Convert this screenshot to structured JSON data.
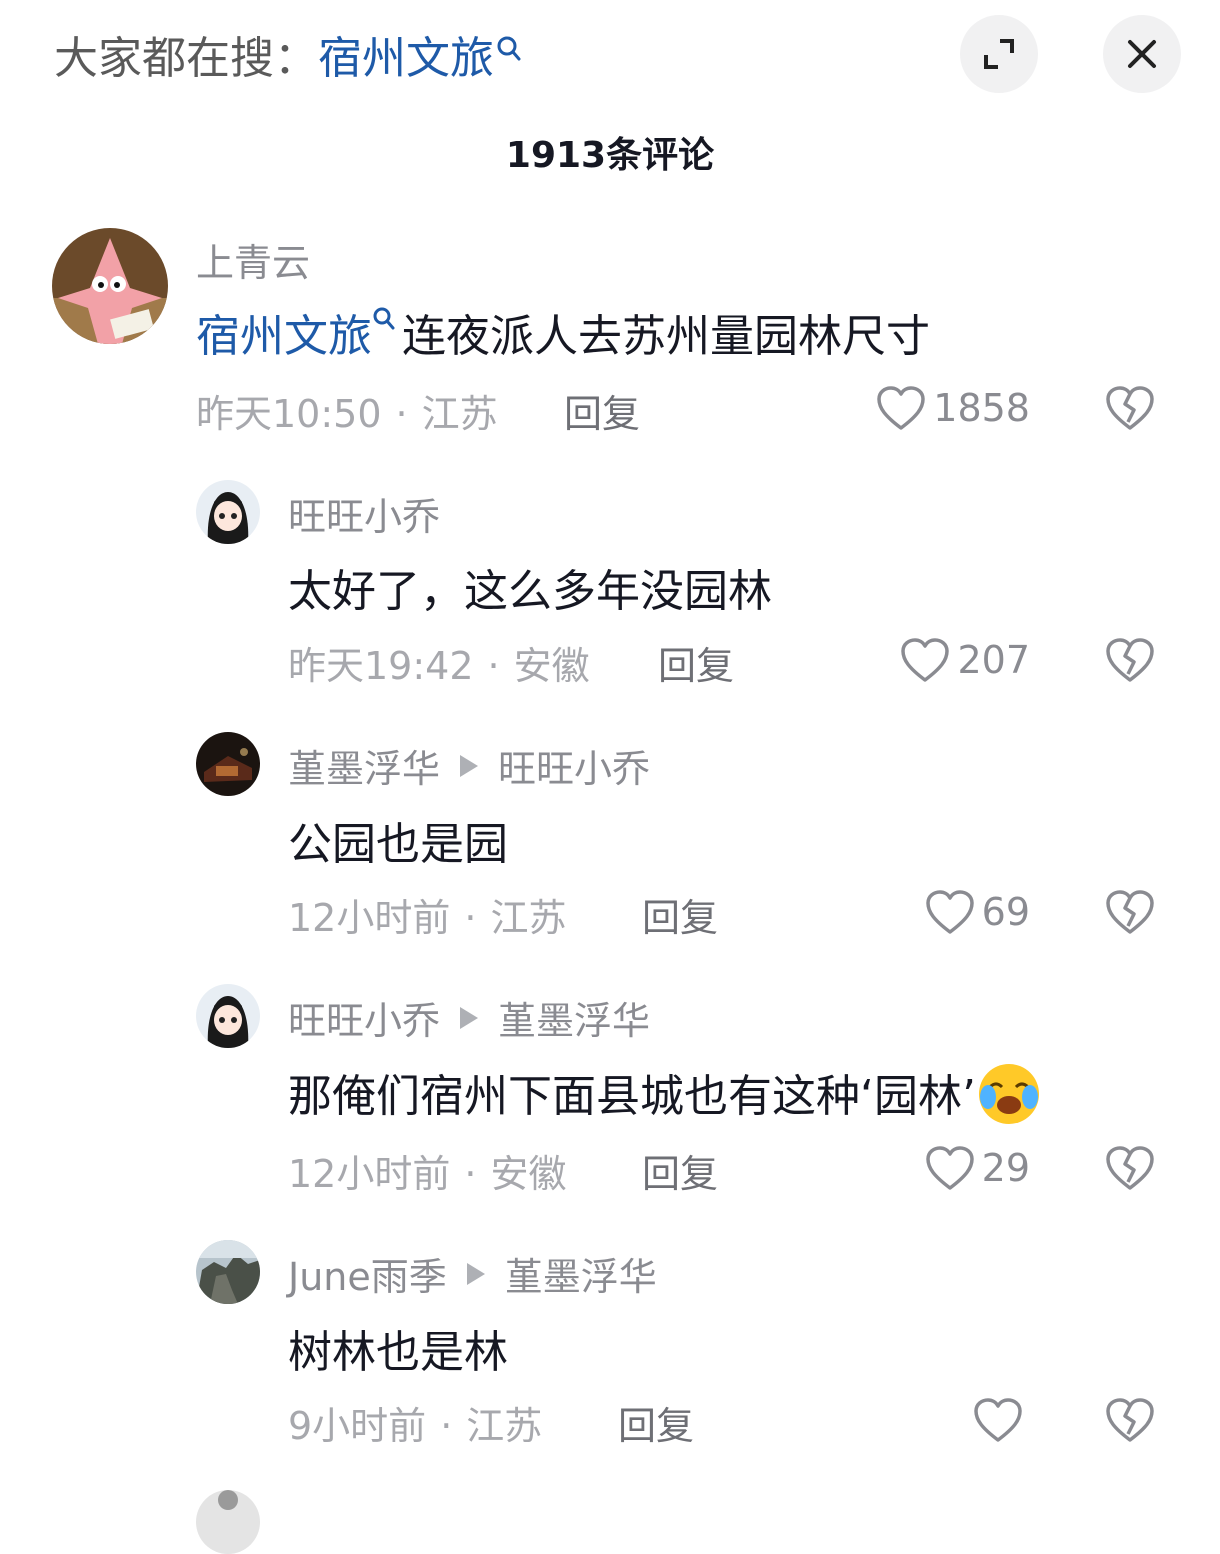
{
  "header": {
    "search_prefix": "大家都在搜：",
    "search_term": "宿州文旅",
    "comment_count": "1913条评论"
  },
  "comments": [
    {
      "username": "上青云",
      "link": "宿州文旅",
      "text": "连夜派人去苏州量园林尺寸",
      "time": "昨天10:50",
      "location": "江苏",
      "reply_label": "回复",
      "likes": "1858"
    },
    {
      "username": "旺旺小乔",
      "text": "太好了，这么多年没园林",
      "time": "昨天19:42",
      "location": "安徽",
      "reply_label": "回复",
      "likes": "207"
    },
    {
      "username": "堇墨浮华",
      "reply_to": "旺旺小乔",
      "text": "公园也是园",
      "time": "12小时前",
      "location": "江苏",
      "reply_label": "回复",
      "likes": "69"
    },
    {
      "username": "旺旺小乔",
      "reply_to": "堇墨浮华",
      "text": "那俺们宿州下面县城也有这种‘园林’",
      "time": "12小时前",
      "location": "安徽",
      "reply_label": "回复",
      "likes": "29"
    },
    {
      "username": "June雨季",
      "reply_to": "堇墨浮华",
      "text": "树林也是林",
      "time": "9小时前",
      "location": "江苏",
      "reply_label": "回复",
      "likes": ""
    }
  ],
  "colors": {
    "link": "#1e5aa8",
    "meta": "#a7a8ad",
    "username": "#8a8b91"
  }
}
